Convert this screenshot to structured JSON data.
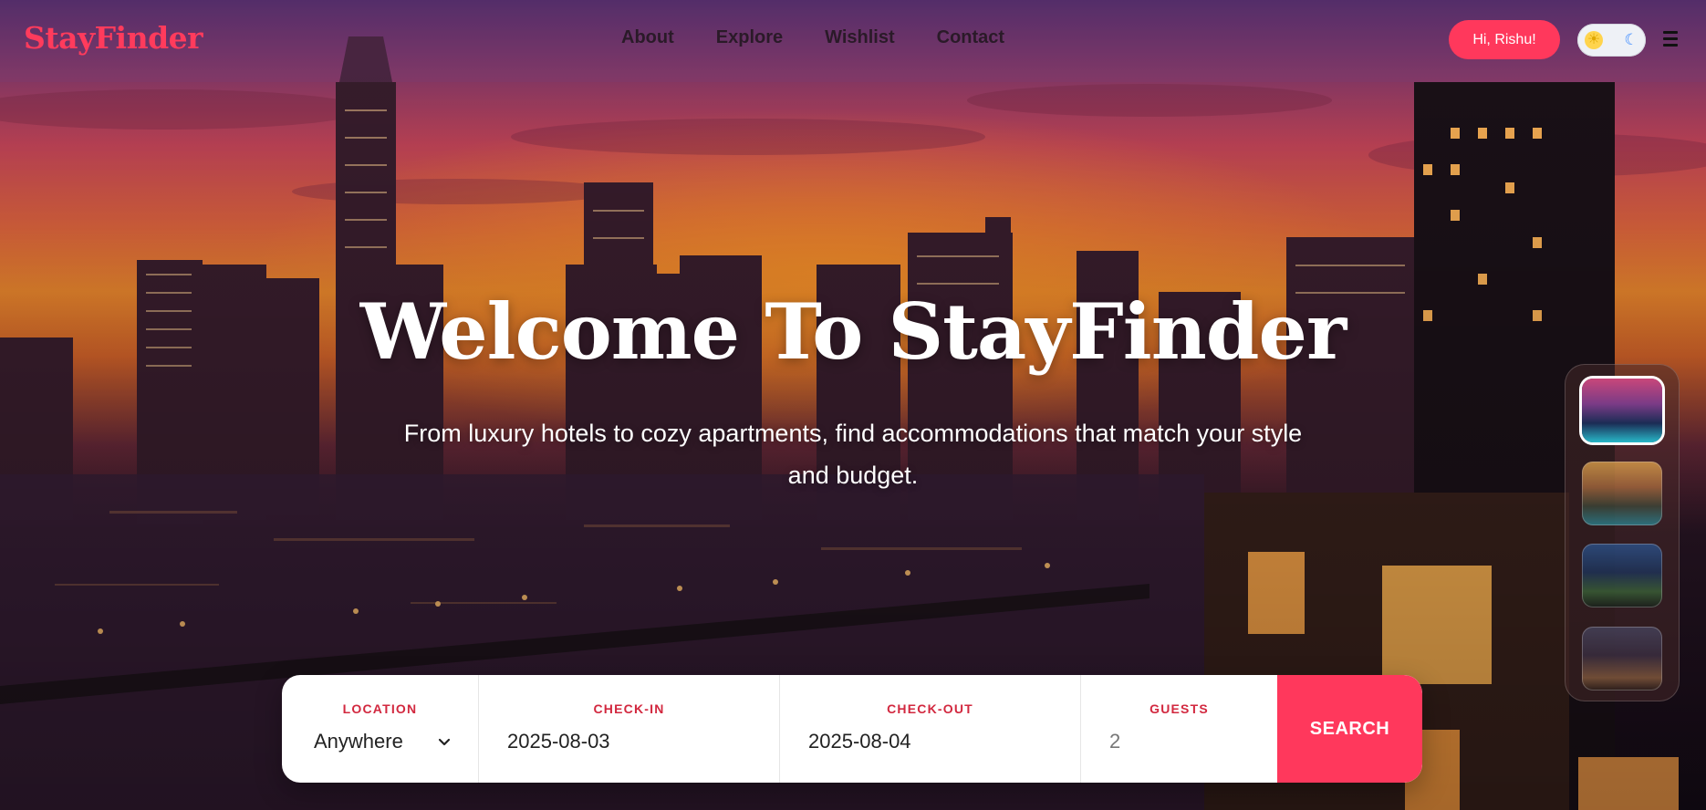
{
  "header": {
    "logo": "StayFinder",
    "nav": [
      {
        "label": "About"
      },
      {
        "label": "Explore"
      },
      {
        "label": "Wishlist"
      },
      {
        "label": "Contact"
      }
    ],
    "greeting_button": "Hi, Rishu!",
    "theme_toggle": {
      "light_icon": "sun-icon",
      "dark_icon": "moon-icon"
    },
    "menu_icon": "hamburger-icon"
  },
  "hero": {
    "title": "Welcome To StayFinder",
    "subtitle": "From luxury hotels to cozy apartments, find accommodations that match your style and budget."
  },
  "search": {
    "location": {
      "label": "LOCATION",
      "value": "Anywhere"
    },
    "check_in": {
      "label": "CHECK-IN",
      "value": "2025-08-03"
    },
    "check_out": {
      "label": "CHECK-OUT",
      "value": "2025-08-04"
    },
    "guests": {
      "label": "GUESTS",
      "value": "2"
    },
    "button_label": "SEARCH"
  },
  "thumbnails": [
    {
      "name": "city-skyline-pool",
      "active": true
    },
    {
      "name": "tropical-resort",
      "active": false
    },
    {
      "name": "night-building",
      "active": false
    },
    {
      "name": "terrace-lounge",
      "active": false
    }
  ],
  "colors": {
    "brand": "#ff385c",
    "label_red": "#d2283f",
    "logo": "#ff3b5c"
  }
}
